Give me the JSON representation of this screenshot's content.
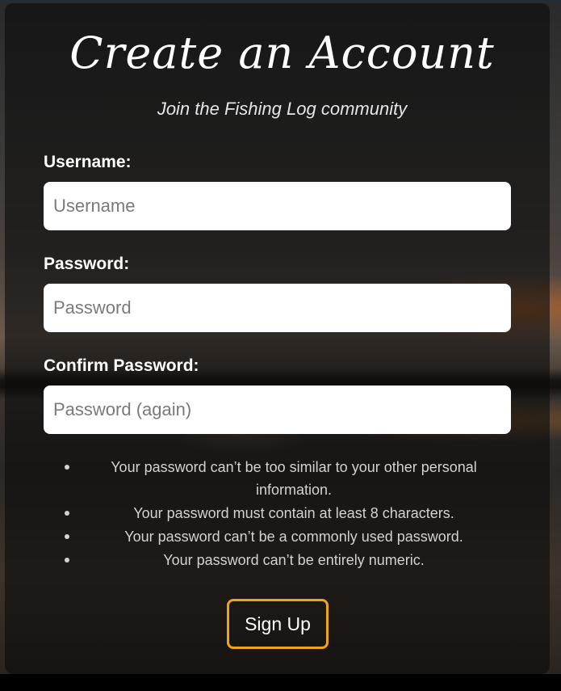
{
  "header": {
    "title": "Create an Account",
    "subtitle": "Join the Fishing Log community"
  },
  "form": {
    "username": {
      "label": "Username:",
      "placeholder": "Username",
      "value": ""
    },
    "password": {
      "label": "Password:",
      "placeholder": "Password",
      "value": ""
    },
    "confirm_password": {
      "label": "Confirm Password:",
      "placeholder": "Password (again)",
      "value": ""
    },
    "help_texts": [
      "Your password can’t be too similar to your other personal information.",
      "Your password must contain at least 8 characters.",
      "Your password can’t be a commonly used password.",
      "Your password can’t be entirely numeric."
    ],
    "submit_label": "Sign Up"
  },
  "colors": {
    "accent": "#f0a417",
    "card_background": "rgba(12,12,12,0.62)"
  }
}
